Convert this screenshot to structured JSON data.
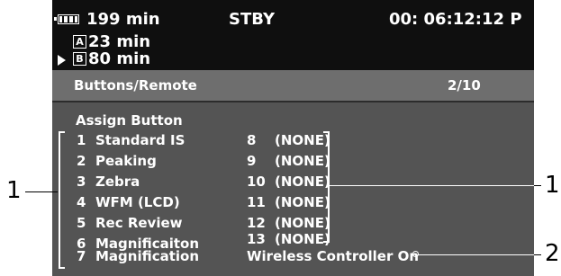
{
  "status": {
    "battery_time": "199 min",
    "slot_a_label": "A",
    "slot_a_time": "23 min",
    "slot_b_label": "B",
    "slot_b_time": "80 min",
    "mode": "STBY",
    "timecode": "00: 06:12:12 P"
  },
  "menu": {
    "title": "Buttons/Remote",
    "page": "2/10",
    "section": "Assign Button",
    "left_items": [
      {
        "num": "1",
        "label": "Standard IS"
      },
      {
        "num": "2",
        "label": "Peaking"
      },
      {
        "num": "3",
        "label": "Zebra"
      },
      {
        "num": "4",
        "label": "WFM (LCD)"
      },
      {
        "num": "5",
        "label": "Rec Review"
      },
      {
        "num": "6",
        "label": "Magnificaiton"
      },
      {
        "num": "7",
        "label": "Magnification"
      }
    ],
    "right_items": [
      {
        "num": "8",
        "value": "(NONE)"
      },
      {
        "num": "9",
        "value": "(NONE)"
      },
      {
        "num": "10",
        "value": "(NONE)"
      },
      {
        "num": "11",
        "value": "(NONE)"
      },
      {
        "num": "12",
        "value": "(NONE)"
      },
      {
        "num": "13",
        "value": "(NONE)"
      }
    ],
    "wireless": "Wireless Controller On"
  },
  "callouts": {
    "left": "1",
    "right_top": "1",
    "right_bottom": "2"
  },
  "icons": {
    "battery": "battery-icon",
    "selector": "selector-arrow-icon"
  },
  "colors": {
    "top_bar": "#0f0f0f",
    "title_bar": "#6e6e6e",
    "menu_bg": "#545454",
    "text": "#ffffff"
  }
}
